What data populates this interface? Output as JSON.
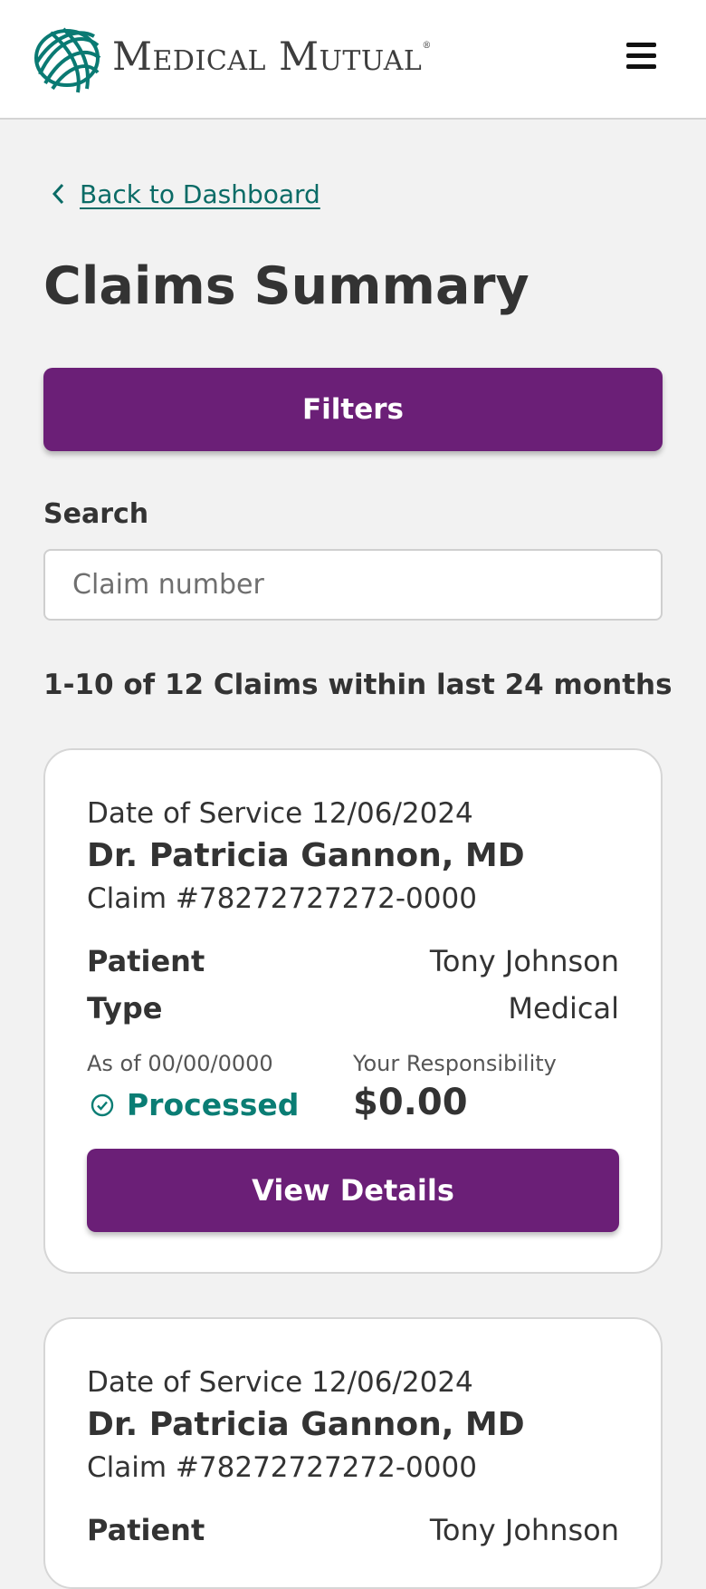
{
  "header": {
    "brand_name": "Medical Mutual",
    "brand_reg": "®",
    "menu_icon": "hamburger-icon"
  },
  "nav": {
    "back_label": "Back to Dashboard",
    "back_icon": "chevron-left-icon"
  },
  "page": {
    "title": "Claims Summary"
  },
  "filters": {
    "button_label": "Filters"
  },
  "search": {
    "label": "Search",
    "placeholder": "Claim number",
    "value": ""
  },
  "results": {
    "summary": "1-10 of 12 Claims within last 24 months"
  },
  "claims": [
    {
      "date_of_service": "Date of Service 12/06/2024",
      "provider": "Dr. Patricia Gannon, MD",
      "claim_number": "Claim #78272727272-0000",
      "patient_label": "Patient",
      "patient": "Tony Johnson",
      "type_label": "Type",
      "type": "Medical",
      "as_of": "As of 00/00/0000",
      "status": "Processed",
      "status_icon": "check-circle-icon",
      "responsibility_label": "Your Responsibility",
      "responsibility": "$0.00",
      "details_label": "View Details"
    },
    {
      "date_of_service": "Date of Service 12/06/2024",
      "provider": "Dr. Patricia Gannon, MD",
      "claim_number": "Claim #78272727272-0000",
      "patient_label": "Patient",
      "patient": "Tony Johnson"
    }
  ],
  "colors": {
    "brand_purple": "#6b1f77",
    "accent_teal": "#0a6b66",
    "status_green": "#0a7d74",
    "page_bg": "#f2f2f2"
  }
}
